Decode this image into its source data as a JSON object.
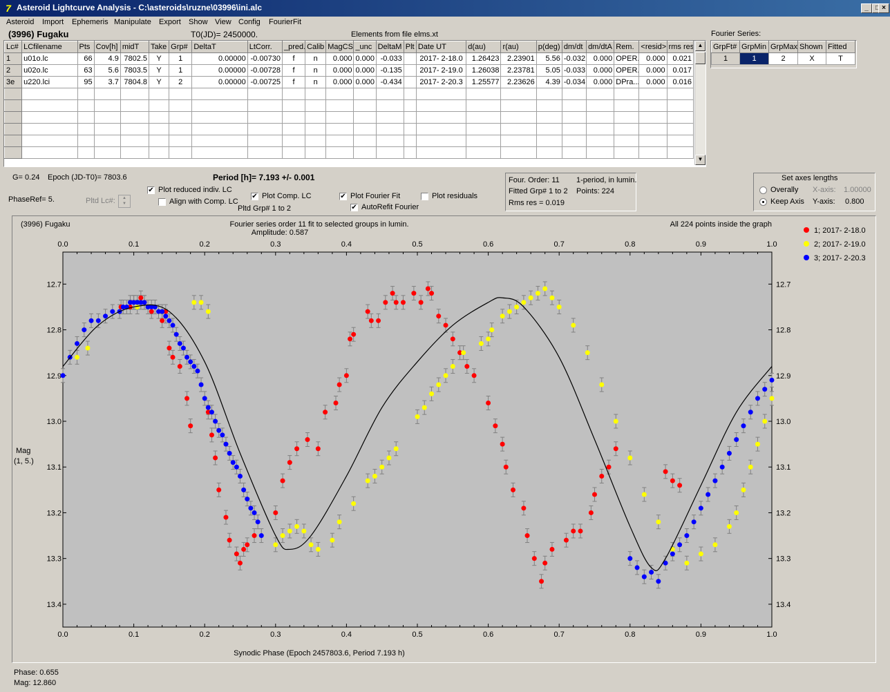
{
  "window": {
    "title": "Asteroid Lightcurve Analysis - C:\\asteroids\\ruzne\\03996\\ini.alc",
    "icon_glyph": "7",
    "min_glyph": "_",
    "max_glyph": "□",
    "close_glyph": "×"
  },
  "menu": [
    "Asteroid",
    "Import",
    "Ephemeris",
    "Manipulate",
    "Export",
    "Show",
    "View",
    "Config",
    "FourierFit"
  ],
  "header": {
    "asteroid_name": "(3996) Fugaku",
    "t0": "T0(JD)= 2450000.",
    "elements": "Elements from file elms.xt"
  },
  "lc_table": {
    "columns": [
      "Lc#",
      "LCfilename",
      "Pts",
      "Cov[h]",
      "midT",
      "Take",
      "Grp#",
      "DeltaT",
      "LtCorr.",
      "_pred.",
      "Calib",
      "MagCS",
      "_unc",
      "DeltaM",
      "Plt",
      "Date UT",
      "d(au)",
      "r(au)",
      "p(deg)",
      "dm/dt",
      "dm/dtA",
      "Rem.",
      "<resid>",
      "rms res"
    ],
    "rows": [
      [
        "1",
        "u01o.lc",
        "66",
        "4.9",
        "7802.5",
        "Y",
        "1",
        "0.00000",
        "-0.00730",
        "f",
        "n",
        "0.000",
        "0.000",
        "-0.033",
        "",
        "2017- 2-18.0",
        "1.26423",
        "2.23901",
        "5.56",
        "-0.032",
        "0.000",
        "OPER.",
        "0.000",
        "0.021"
      ],
      [
        "2",
        "u02o.lc",
        "63",
        "5.6",
        "7803.5",
        "Y",
        "1",
        "0.00000",
        "-0.00728",
        "f",
        "n",
        "0.000",
        "0.000",
        "-0.135",
        "",
        "2017- 2-19.0",
        "1.26038",
        "2.23781",
        "5.05",
        "-0.033",
        "0.000",
        "OPER.",
        "0.000",
        "0.017"
      ],
      [
        "3e",
        "u220.lci",
        "95",
        "3.7",
        "7804.8",
        "Y",
        "2",
        "0.00000",
        "-0.00725",
        "f",
        "n",
        "0.000",
        "0.000",
        "-0.434",
        "",
        "2017- 2-20.3",
        "1.25577",
        "2.23626",
        "4.39",
        "-0.034",
        "0.000",
        "DPra...",
        "0.000",
        "0.016"
      ]
    ],
    "empty_rows": 6
  },
  "fourier_table": {
    "caption": "Fourier Series:",
    "columns": [
      "GrpFt#",
      "GrpMin",
      "GrpMax",
      "Shown",
      "Fitted"
    ],
    "row": [
      "1",
      "1",
      "2",
      "X",
      "T"
    ]
  },
  "controls": {
    "g": "G= 0.24",
    "epoch": "Epoch (JD-T0)= 7803.6",
    "period": "Period [h]= 7.193 +/- 0.001",
    "phaseref": "PhaseRef= 5.",
    "pltd_lc": "Pltd Lc#:",
    "plot_reduced": "Plot reduced indiv. LC",
    "align": "Align with Comp. LC",
    "plot_comp": "Plot Comp. LC",
    "pltd_grp": "Pltd Grp#  1   to   2",
    "plot_fourier": "Plot Fourier Fit",
    "autorefit": "AutoRefit Fourier",
    "plot_resid": "Plot residuals",
    "four_order": "Four. Order: 11",
    "one_period": "1-period, in lumin.",
    "fitted_grp": "Fitted Grp# 1 to 2",
    "points": "Points: 224",
    "rms": "Rms res     = 0.019",
    "axes_title": "Set axes lengths",
    "overally": "Overally",
    "keep_axis": "Keep Axis",
    "x_axis_label": "X-axis:",
    "x_axis_value": "1.00000",
    "y_axis_label": "Y-axis:",
    "y_axis_value": "0.800",
    "check": "✔"
  },
  "status": {
    "phase": "Phase:  0.655",
    "mag": "Mag:    12.860"
  },
  "chart_data": {
    "type": "scatter",
    "title": "(3996) Fugaku",
    "subtitle": "Fourier series order 11 fit to selected groups in lumin.",
    "amplitude": "Amplitude: 0.587",
    "note": "All 224 points inside the graph",
    "xlabel": "Synodic Phase (Epoch 2457803.6, Period 7.193 h)",
    "ylabel": "Mag",
    "ylabel2": "(1, 5.)",
    "xlim": [
      0,
      1
    ],
    "ylim": [
      13.45,
      12.63
    ],
    "xticks": [
      "0.0",
      "0.1",
      "0.2",
      "0.3",
      "0.4",
      "0.5",
      "0.6",
      "0.7",
      "0.8",
      "0.9",
      "1.0"
    ],
    "yticks": [
      "12.7",
      "12.8",
      "12.9",
      "13.0",
      "13.1",
      "13.2",
      "13.3",
      "13.4"
    ],
    "legend_position": "top-right",
    "series": [
      {
        "name": "1; 2017- 2-18.0",
        "color": "#ff0000",
        "x": [
          0.082,
          0.095,
          0.1,
          0.11,
          0.115,
          0.125,
          0.14,
          0.145,
          0.15,
          0.155,
          0.165,
          0.175,
          0.18,
          0.205,
          0.21,
          0.215,
          0.22,
          0.23,
          0.235,
          0.245,
          0.25,
          0.255,
          0.26,
          0.27,
          0.3,
          0.31,
          0.32,
          0.33,
          0.345,
          0.36,
          0.37,
          0.385,
          0.39,
          0.4,
          0.405,
          0.41,
          0.43,
          0.435,
          0.445,
          0.455,
          0.465,
          0.47,
          0.48,
          0.495,
          0.505,
          0.515,
          0.52,
          0.53,
          0.54,
          0.55,
          0.56,
          0.57,
          0.58,
          0.6,
          0.61,
          0.62,
          0.625,
          0.635,
          0.65,
          0.655,
          0.665,
          0.675,
          0.68,
          0.69,
          0.71,
          0.72,
          0.73,
          0.745,
          0.75,
          0.76,
          0.77,
          0.78,
          0.85,
          0.86,
          0.87
        ],
        "y": [
          12.75,
          12.75,
          12.74,
          12.73,
          12.74,
          12.76,
          12.78,
          12.76,
          12.84,
          12.86,
          12.88,
          12.95,
          13.01,
          12.98,
          13.03,
          13.08,
          13.15,
          13.21,
          13.26,
          13.29,
          13.31,
          13.28,
          13.27,
          13.25,
          13.2,
          13.13,
          13.09,
          13.06,
          13.04,
          13.06,
          12.98,
          12.96,
          12.92,
          12.9,
          12.82,
          12.81,
          12.76,
          12.78,
          12.78,
          12.74,
          12.72,
          12.74,
          12.74,
          12.72,
          12.74,
          12.71,
          12.72,
          12.77,
          12.79,
          12.82,
          12.85,
          12.88,
          12.9,
          12.96,
          13.01,
          13.05,
          13.1,
          13.15,
          13.19,
          13.25,
          13.3,
          13.35,
          13.31,
          13.28,
          13.26,
          13.24,
          13.24,
          13.2,
          13.16,
          13.12,
          13.1,
          13.06,
          13.11,
          13.13,
          13.14
        ]
      },
      {
        "name": "2; 2017- 2-19.0",
        "color": "#ffff00",
        "x": [
          0.02,
          0.035,
          0.105,
          0.185,
          0.195,
          0.205,
          0.3,
          0.31,
          0.32,
          0.33,
          0.34,
          0.35,
          0.36,
          0.38,
          0.39,
          0.41,
          0.43,
          0.44,
          0.45,
          0.46,
          0.47,
          0.5,
          0.51,
          0.52,
          0.53,
          0.54,
          0.55,
          0.565,
          0.59,
          0.6,
          0.605,
          0.62,
          0.63,
          0.64,
          0.65,
          0.66,
          0.67,
          0.68,
          0.69,
          0.7,
          0.72,
          0.74,
          0.76,
          0.78,
          0.8,
          0.82,
          0.84,
          0.86,
          0.88,
          0.9,
          0.92,
          0.94,
          0.95,
          0.96,
          0.97,
          0.98,
          0.99,
          1.0
        ],
        "y": [
          12.86,
          12.84,
          12.75,
          12.74,
          12.74,
          12.76,
          13.27,
          13.25,
          13.24,
          13.23,
          13.24,
          13.27,
          13.28,
          13.26,
          13.22,
          13.18,
          13.13,
          13.12,
          13.1,
          13.08,
          13.06,
          12.99,
          12.97,
          12.94,
          12.92,
          12.9,
          12.88,
          12.85,
          12.83,
          12.82,
          12.8,
          12.77,
          12.76,
          12.75,
          12.74,
          12.73,
          12.72,
          12.71,
          12.73,
          12.75,
          12.79,
          12.85,
          12.92,
          13.0,
          13.08,
          13.16,
          13.22,
          13.28,
          13.31,
          13.29,
          13.27,
          13.23,
          13.2,
          13.15,
          13.1,
          13.05,
          13.0,
          12.95
        ]
      },
      {
        "name": "3; 2017- 2-20.3",
        "color": "#0000ff",
        "x": [
          0.0,
          0.01,
          0.02,
          0.03,
          0.04,
          0.05,
          0.06,
          0.07,
          0.08,
          0.085,
          0.09,
          0.095,
          0.1,
          0.105,
          0.11,
          0.115,
          0.12,
          0.125,
          0.13,
          0.135,
          0.14,
          0.145,
          0.15,
          0.155,
          0.16,
          0.165,
          0.17,
          0.175,
          0.18,
          0.185,
          0.19,
          0.195,
          0.2,
          0.205,
          0.21,
          0.215,
          0.22,
          0.225,
          0.23,
          0.235,
          0.24,
          0.245,
          0.25,
          0.255,
          0.26,
          0.265,
          0.27,
          0.275,
          0.28,
          0.8,
          0.81,
          0.82,
          0.83,
          0.84,
          0.85,
          0.86,
          0.87,
          0.88,
          0.89,
          0.9,
          0.91,
          0.92,
          0.93,
          0.94,
          0.95,
          0.96,
          0.97,
          0.98,
          0.99,
          1.0
        ],
        "y": [
          12.9,
          12.86,
          12.83,
          12.8,
          12.78,
          12.78,
          12.77,
          12.76,
          12.76,
          12.75,
          12.75,
          12.74,
          12.74,
          12.74,
          12.74,
          12.74,
          12.75,
          12.75,
          12.75,
          12.76,
          12.76,
          12.77,
          12.78,
          12.79,
          12.81,
          12.83,
          12.84,
          12.86,
          12.87,
          12.88,
          12.89,
          12.92,
          12.95,
          12.97,
          12.98,
          13.0,
          13.02,
          13.03,
          13.05,
          13.07,
          13.09,
          13.1,
          13.12,
          13.15,
          13.17,
          13.19,
          13.2,
          13.22,
          13.25,
          13.3,
          13.32,
          13.34,
          13.33,
          13.35,
          13.31,
          13.29,
          13.27,
          13.25,
          13.22,
          13.19,
          13.16,
          13.13,
          13.1,
          13.07,
          13.04,
          13.01,
          12.98,
          12.95,
          12.93,
          12.91
        ]
      }
    ],
    "fit": {
      "x": [
        0.0,
        0.05,
        0.1,
        0.15,
        0.2,
        0.25,
        0.3,
        0.32,
        0.35,
        0.4,
        0.45,
        0.5,
        0.55,
        0.6,
        0.62,
        0.65,
        0.7,
        0.75,
        0.8,
        0.83,
        0.85,
        0.9,
        0.95,
        1.0
      ],
      "y": [
        12.88,
        12.79,
        12.75,
        12.76,
        12.87,
        13.07,
        13.25,
        13.28,
        13.25,
        13.12,
        12.97,
        12.87,
        12.79,
        12.74,
        12.73,
        12.75,
        12.86,
        13.04,
        13.23,
        13.32,
        13.3,
        13.14,
        12.98,
        12.88
      ]
    }
  }
}
